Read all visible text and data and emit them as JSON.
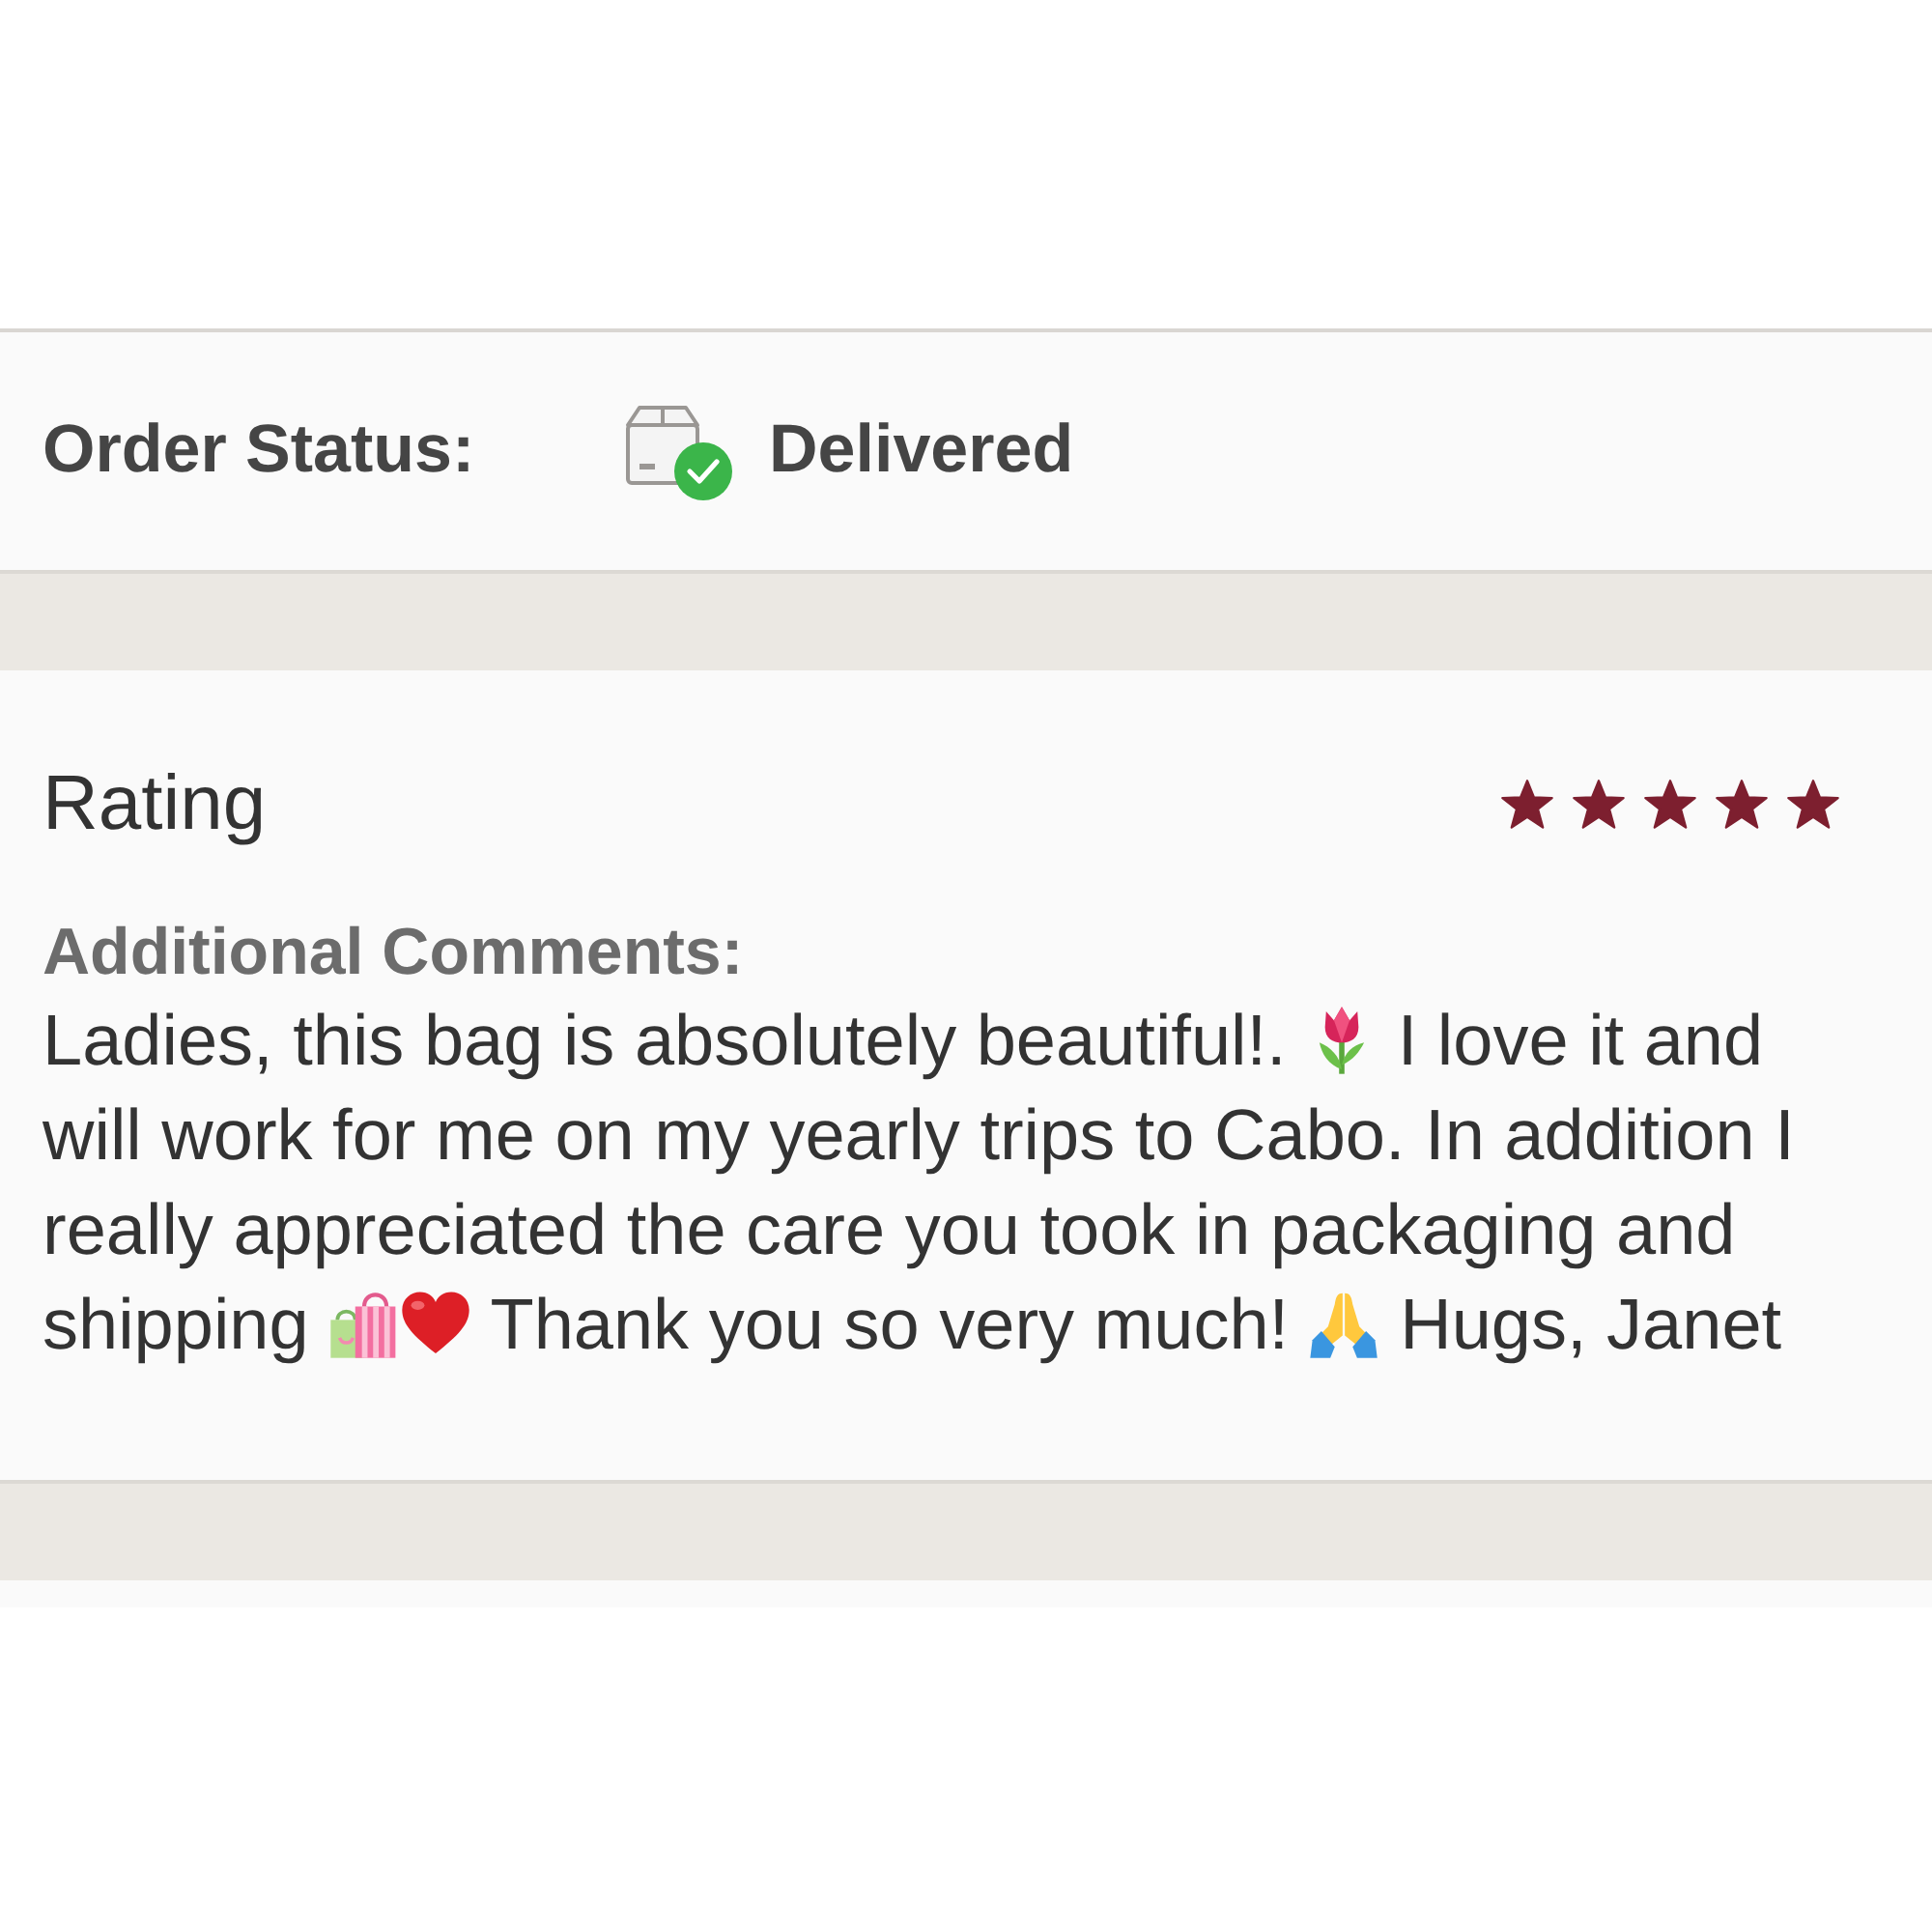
{
  "order_status": {
    "label": "Order Status:",
    "status": "Delivered"
  },
  "review": {
    "title": "Rating",
    "stars": 5,
    "comments_label": "Additional Comments:",
    "comment": [
      {
        "kind": "text",
        "text": "Ladies, this bag is absolutely beautiful!. "
      },
      {
        "kind": "tulip"
      },
      {
        "kind": "text",
        "text": " I love it and will work for me on my yearly trips to Cabo. In addition I really appreciated the care you took in packaging and shipping "
      },
      {
        "kind": "bags"
      },
      {
        "kind": "heart"
      },
      {
        "kind": "text",
        "text": " Thank you so very much! "
      },
      {
        "kind": "hands"
      },
      {
        "kind": "text",
        "text": " Hugs, Janet"
      }
    ]
  }
}
